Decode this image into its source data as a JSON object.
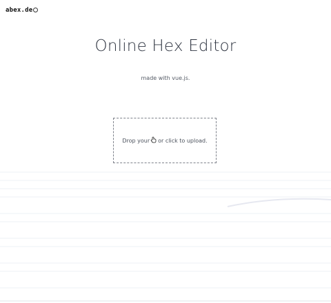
{
  "header": {
    "logo_text": "abex.de",
    "logo_icon": "pen-mark-icon"
  },
  "main": {
    "title": "Online Hex Editor",
    "subtitle": "made with vue.js."
  },
  "upload": {
    "text_before": "Drop your",
    "text_after": "or click to upload.",
    "cursor_icon": "hand-cursor-icon"
  },
  "colors": {
    "background": "#ffffff",
    "title": "#2e3440",
    "border": "#7d818a"
  }
}
